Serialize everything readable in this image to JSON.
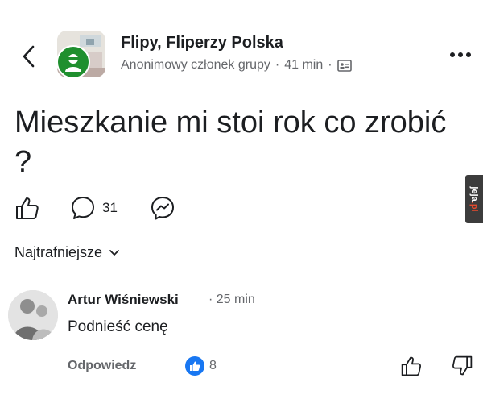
{
  "header": {
    "group_name": "Flipy, Fliperzy Polska",
    "author": "Anonimowy członek grupy",
    "separator": "·",
    "time": "41 min",
    "back_icon": "chevron-left-icon",
    "more_icon": "more-horizontal-icon",
    "audience_icon": "group-audience-icon"
  },
  "post": {
    "title": "Mieszkanie mi stoi rok co zrobić ?",
    "comment_count": "31"
  },
  "watermark": {
    "text_a": "jeja",
    "text_b": ".pl"
  },
  "comments": {
    "sort_label": "Najtrafniejsze",
    "items": [
      {
        "author": "Artur Wiśniewski",
        "separator": "·",
        "time": "25 min",
        "text": "Podnieść cenę",
        "reply_label": "Odpowiedz",
        "like_count": "8"
      }
    ]
  },
  "colors": {
    "accent": "#1877f2",
    "secondary_text": "#65676b",
    "anon_badge": "#1f8f2e"
  }
}
